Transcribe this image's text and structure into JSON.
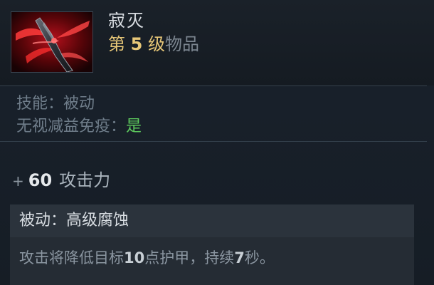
{
  "item": {
    "name": "寂灭",
    "level_prefix": "第",
    "level_number": "5",
    "level_suffix": "级",
    "level_type": "物品",
    "icon": "blade-of-desolation-icon"
  },
  "properties": {
    "skill_label": "技能：",
    "skill_value": "被动",
    "debuff_label": "无视减益免疫：",
    "debuff_value": "是"
  },
  "stat": {
    "plus": "+",
    "value": "60",
    "name": "攻击力"
  },
  "ability": {
    "title": "被动：高级腐蚀",
    "desc_part1": "攻击将降低目标",
    "armor_value": "10",
    "desc_part2": "点护甲，持续",
    "duration_value": "7",
    "desc_part3": "秒。"
  },
  "colors": {
    "gold": "#e7c778",
    "green": "#5dc95d",
    "background": "#181f26"
  }
}
